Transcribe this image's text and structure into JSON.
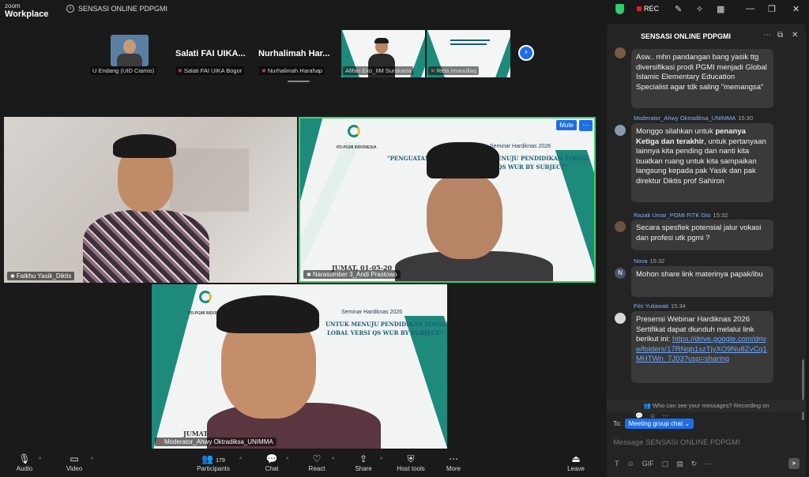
{
  "app": {
    "brand_top": "zoom",
    "brand_bottom": "Workplace",
    "meeting_title": "SENSASI ONLINE PDPGMI",
    "rec_label": "REC"
  },
  "filmstrip": {
    "names": [
      "U Endang (UID Ciamis)",
      "Salati FAI UIKA Bogor",
      "Nurhalimah Harahap",
      "Afifan Eko_IIM Surakarta",
      "Rela Imanullaq"
    ],
    "big_names": [
      "Salati FAI UIKA...",
      "Nurhalimah Har..."
    ]
  },
  "tiles": {
    "t1_name": "Fatkhu Yasik_Diktis",
    "t2_name": "Narasumber 3_Andi Prastowo",
    "t3_name": "Moderator_Ahwy Oktradiksa_UNIMMA",
    "mute_label": "Mute",
    "slide": {
      "org": "PD-PGMI INDONESIA",
      "event": "Seminar Hardiknas 2026",
      "line1": "\"PENGUATAN PROG",
      "line1b": "K MENUJU PENDIDIKAN TINGGI",
      "line2": "VERSI QS WUR BY SUBJECT\"",
      "date": "JUMAT, 01-05-20",
      "t3_line1": "UNTUK MENUJU PENDIDIKAN TINGGI",
      "t3_line2": "LOBAL VERSI QS WUR BY SUBJECT\"",
      "t3_date": "JUMAT, 01-05-202"
    }
  },
  "chat": {
    "title": "SENSASI ONLINE PDPGMI",
    "messages": [
      {
        "text": "Asw.. mhn pandangan bang yasik ttg diversifikasi prodi PGMI menjadi Global Islamic Elementary Education Specialist agar tdk saling \"memangsa\""
      },
      {
        "sender": "Moderator_Ahwy Oktradiksa_UNIMMA",
        "time": "15:30",
        "pre": "Monggo silahkan untuk ",
        "bold": "penanya Ketiga dan terakhir",
        "post": ", untuk pertanyaan lainnya kita pending dan nanti kita buatkan ruang untuk kita sampaikan langsung kepada pak Yasik dan pak direktur Diktis prof Sahiron"
      },
      {
        "sender": "Razak Umar_PGMI FITK Gto",
        "time": "15:32",
        "text": "Secara spesfiek potensial jalur vokasi dan profesi  utk pgmi ?"
      },
      {
        "sender": "Nova",
        "time": "15:32",
        "initial": "N",
        "text": "Mohon share link materinya papak/ibu"
      },
      {
        "sender": "Fitri Yuliawati",
        "time": "15:34",
        "text": "Presensi Webinar Hardiknas 2026 Sertifikat dapat diunduh melalui link berikut ini:",
        "link": "https://drive.google.com/drive/folders/17RNqb1szTjyXO9Nu8ZvCq1MHTWn_7J03?usp=sharing"
      }
    ],
    "notice": "Who can see your messages? Recording on",
    "to_label": "To:",
    "to_value": "Meeting group chat",
    "input_placeholder": "Message SENSASI ONLINE PDPGMI",
    "gif_label": "GIF"
  },
  "toolbar": {
    "audio": "Audio",
    "video": "Video",
    "participants": "Participants",
    "participants_count": "179",
    "chat": "Chat",
    "react": "React",
    "share": "Share",
    "host_tools": "Host tools",
    "more": "More",
    "leave": "Leave"
  }
}
